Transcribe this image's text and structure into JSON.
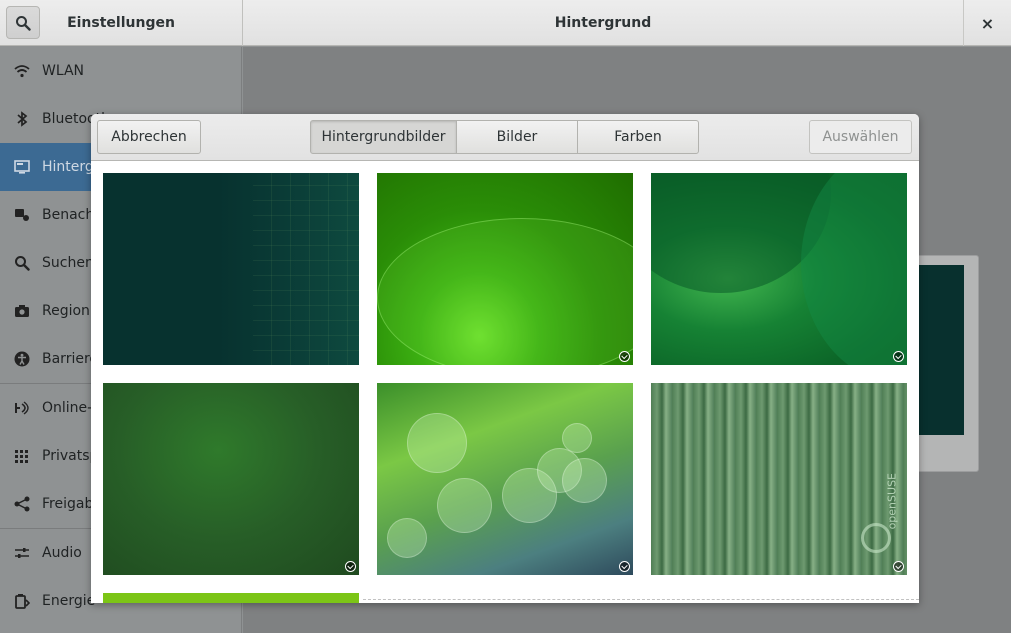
{
  "header": {
    "left_title": "Einstellungen",
    "title": "Hintergrund",
    "close_glyph": "×",
    "search_icon": "search-icon"
  },
  "sidebar": {
    "items": [
      {
        "label": "WLAN",
        "icon": "wifi-icon"
      },
      {
        "label": "Bluetooth",
        "icon": "bluetooth-icon"
      },
      {
        "label": "Hintergrund",
        "icon": "background-icon",
        "active": true
      },
      {
        "label": "Benachrichtigungen",
        "icon": "notifications-icon"
      },
      {
        "label": "Suchen",
        "icon": "search-icon"
      },
      {
        "label": "Region",
        "icon": "camera-icon"
      },
      {
        "label": "Barrierefreiheit",
        "icon": "accessibility-icon"
      },
      {
        "label": "Online-Konten",
        "icon": "online-accounts-icon"
      },
      {
        "label": "Privatsphäre",
        "icon": "privacy-icon"
      },
      {
        "label": "Freigabe",
        "icon": "share-icon"
      },
      {
        "label": "Audio",
        "icon": "audio-icon"
      },
      {
        "label": "Energie",
        "icon": "power-icon"
      }
    ]
  },
  "dialog": {
    "cancel_label": "Abbrechen",
    "select_label": "Auswählen",
    "tabs": [
      "Hintergrundbilder",
      "Bilder",
      "Farben"
    ],
    "active_tab": "Hintergrundbilder",
    "wallpapers": [
      {
        "name": "wallpaper-1",
        "timed": false
      },
      {
        "name": "wallpaper-2",
        "timed": true
      },
      {
        "name": "wallpaper-3",
        "timed": true
      },
      {
        "name": "wallpaper-4",
        "timed": true
      },
      {
        "name": "wallpaper-5",
        "timed": true
      },
      {
        "name": "wallpaper-6",
        "timed": true,
        "brand_text": "openSUSE"
      }
    ]
  }
}
